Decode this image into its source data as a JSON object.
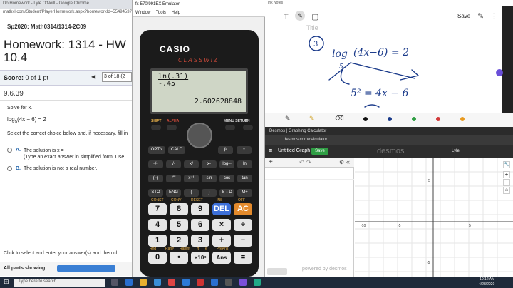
{
  "chrome": {
    "title": "Do Homework - Lyle O'Neill - Google Chrome",
    "url": "mathxl.com/Student/PlayerHomework.aspx?homeworkId=554945375&qu",
    "course": "Sp2020: Math0314/1314-2C09",
    "hw_title_line1": "Homework: 1314 - HW",
    "hw_title_line2": "10.4",
    "score_label": "Score:",
    "score_value": "0 of 1 pt",
    "question_nav": "3 of 18 (2",
    "question_number": "9.6.39",
    "prompt": "Solve for x.",
    "equation_log": "log",
    "equation_base": "5",
    "equation_rest": "(4x − 6) = 2",
    "instruction": "Select the correct choice below and, if necessary, fill in",
    "option_a_letter": "A.",
    "option_a_text": "The solution is x =",
    "option_a_sub": "(Type an exact answer in simplified form. Use",
    "option_b_letter": "B.",
    "option_b_text": "The solution is not a real number.",
    "click_hint": "Click to select and enter your answer(s) and then cl",
    "all_parts": "All parts showing"
  },
  "emulator": {
    "title": "fx-570/991EX Emulator",
    "menu": [
      "Window",
      "Tools",
      "Help"
    ],
    "brand": "CASIO",
    "model": "CLASSWIZ",
    "screen_expr_line1": "ln(.31)",
    "screen_expr_line2": "-.45",
    "screen_result": "2.602628848",
    "top_labels": {
      "shift": "SHIFT",
      "alpha": "ALPHA",
      "menu": "MENU SETUP",
      "on": "ON"
    },
    "row1": [
      "OPTN",
      "CALC",
      "∫▫",
      "x"
    ],
    "row2": [
      "▫/▫",
      "√▫",
      "x²",
      "x▫",
      "log▫▫",
      "ln"
    ],
    "row3": [
      "(−)",
      "°'\"",
      "x⁻¹",
      "sin",
      "cos",
      "tan"
    ],
    "row4": [
      "STO",
      "ENG",
      "(",
      ")",
      "S⇔D",
      "M+"
    ],
    "num_row1": [
      "7",
      "8",
      "9",
      "DEL",
      "AC"
    ],
    "num_row2": [
      "4",
      "5",
      "6",
      "×",
      "÷"
    ],
    "num_row3": [
      "1",
      "2",
      "3",
      "+",
      "−"
    ],
    "num_row4": [
      "0",
      "•",
      "×10ˣ",
      "Ans",
      "="
    ],
    "sub_labels_row1": [
      "CONST",
      "CONV",
      "RESET",
      "INS",
      "OFF"
    ],
    "sub_labels_row4": [
      "Rnd",
      "Ran#",
      "RanInt",
      "π",
      "e",
      "PreAns"
    ]
  },
  "notes": {
    "title": "Ink Notes",
    "save_label": "Save",
    "page_title": "Title",
    "circle_num": "3",
    "handwriting_line1": "log",
    "handwriting_base": "5",
    "handwriting_eq": "(4x−6) = 2",
    "handwriting_line2": "5² = 4x − 6"
  },
  "desmos": {
    "tab_title": "Desmos | Graphing Calculator",
    "url": "desmos.com/calculator",
    "graph_title": "Untitled Graph",
    "save_label": "Save",
    "logo": "desmos",
    "user": "Lyle",
    "axis_labels": [
      "-10",
      "5",
      "-5",
      "5",
      "-5"
    ],
    "powered_by": "powered by desmos"
  },
  "taskbar": {
    "search_placeholder": "Type here to search",
    "time": "10:12 AM",
    "date": "4/28/2020"
  }
}
